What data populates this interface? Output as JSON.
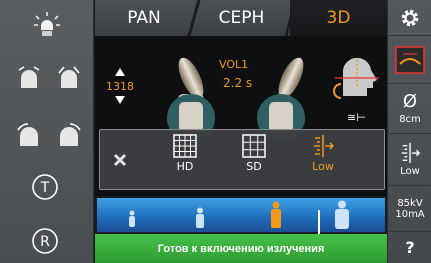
{
  "tabs": [
    {
      "label": "PAN",
      "active": false
    },
    {
      "label": "CEPH",
      "active": false
    },
    {
      "label": "3D",
      "active": true
    }
  ],
  "accent_color": "#f39a1c",
  "stage": {
    "volume": "VOL1",
    "time": "2.2 s",
    "height_value": "1318"
  },
  "left_panel": {
    "items": [
      {
        "icon": "light-icon"
      },
      {
        "icon": "head-tilt-down-icon"
      },
      {
        "icon": "head-tilt-up-icon"
      },
      {
        "icon": "head-side-left-icon"
      },
      {
        "icon": "head-side-right-icon"
      },
      {
        "label": "T"
      },
      {
        "label": "R"
      }
    ]
  },
  "right_panel": {
    "settings_icon": "gear-icon",
    "diameter_symbol": "Ø",
    "diameter_value": "8cm",
    "dose_label": "Low",
    "kv": "85kV",
    "ma": "10mA",
    "help": "?"
  },
  "overlay": {
    "close_icon": "close-icon",
    "options": [
      {
        "label": "HD",
        "icon": "grid-hd-icon"
      },
      {
        "label": "SD",
        "icon": "grid-sd-icon"
      },
      {
        "label": "Low",
        "icon": "low-dose-icon",
        "selected": true
      }
    ]
  },
  "patient_bar": {
    "figures": [
      "child-small-icon",
      "child-icon",
      "adult-medium-icon",
      "adult-large-icon"
    ],
    "selected_index": 2
  },
  "status": "Готов к включению излучения"
}
